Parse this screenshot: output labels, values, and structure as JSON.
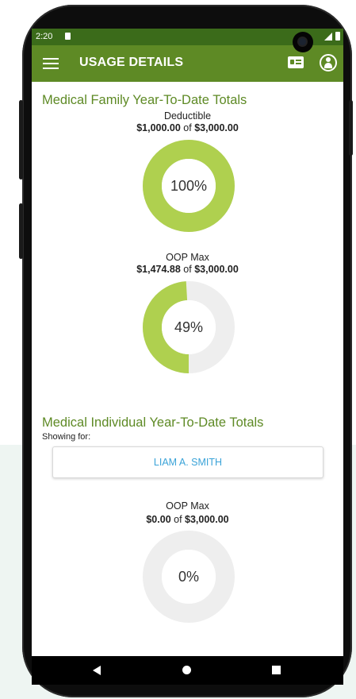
{
  "status_bar": {
    "time": "2:20"
  },
  "app_bar": {
    "title": "USAGE DETAILS",
    "menu_icon": "hamburger-menu-icon",
    "card_icon": "id-card-icon",
    "profile_icon": "profile-icon"
  },
  "family_section": {
    "title": "Medical Family Year-To-Date Totals",
    "rings": [
      {
        "label": "Deductible",
        "used": "$1,000.00",
        "of_word": " of ",
        "total": "$3,000.00",
        "percent_label": "100%",
        "fraction": 1.0
      },
      {
        "label": "OOP Max",
        "used": "$1,474.88",
        "of_word": " of ",
        "total": "$3,000.00",
        "percent_label": "49%",
        "fraction": 0.49
      }
    ]
  },
  "individual_section": {
    "title": "Medical Individual Year-To-Date Totals",
    "showing_for": "Showing for:",
    "member_name": "LIAM A. SMITH",
    "rings": [
      {
        "label": "OOP Max",
        "used": "$0.00",
        "of_word": " of ",
        "total": "$3,000.00",
        "percent_label": "0%",
        "fraction": 0.0
      }
    ]
  },
  "colors": {
    "accent_green": "#5e8a25",
    "ring_fill": "#afd04f",
    "ring_track": "#eeeeee",
    "link_blue": "#3aa3d8"
  }
}
